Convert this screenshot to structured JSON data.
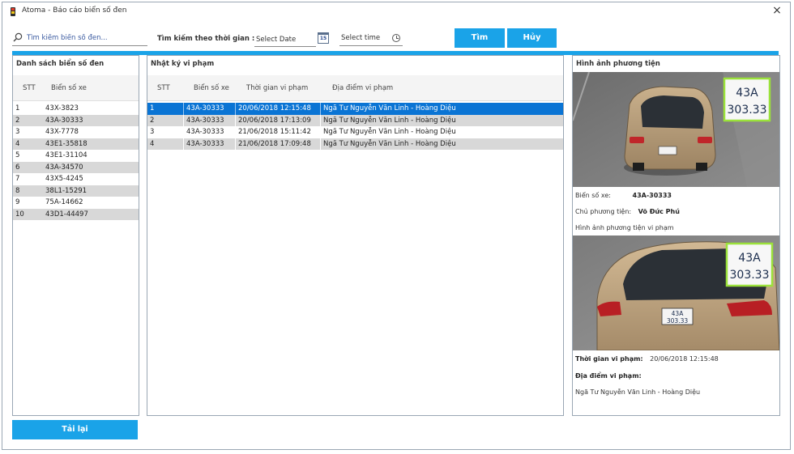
{
  "window": {
    "title": "Atoma - Báo cáo biển số đen",
    "close_glyph": "×"
  },
  "search": {
    "placeholder": "Tìm kiếm biển số đen...",
    "value": ""
  },
  "time_filter": {
    "label": "Tìm kiếm theo thời gian :",
    "date_placeholder": "Select Date",
    "calendar_glyph": "15",
    "time_placeholder": "Select time"
  },
  "buttons": {
    "find": "Tìm",
    "cancel": "Hủy",
    "reload": "Tải lại"
  },
  "colors": {
    "accent": "#1aa3e8",
    "selected_row": "#0a74d4",
    "alt_row": "#d8d8d8",
    "plate_box": "#9be23a"
  },
  "blacklist": {
    "title": "Danh sách biển số đen",
    "headers": [
      "STT",
      "Biển số xe"
    ],
    "rows": [
      [
        "1",
        "43X-3823"
      ],
      [
        "2",
        "43A-30333"
      ],
      [
        "3",
        "43X-7778"
      ],
      [
        "4",
        "43E1-35818"
      ],
      [
        "5",
        "43E1-31104"
      ],
      [
        "6",
        "43A-34570"
      ],
      [
        "7",
        "43X5-4245"
      ],
      [
        "8",
        "38L1-15291"
      ],
      [
        "9",
        "75A-14662"
      ],
      [
        "10",
        "43D1-44497"
      ]
    ]
  },
  "violations": {
    "title": "Nhật ký vi phạm",
    "headers": [
      "STT",
      "Biển số xe",
      "Thời gian vi phạm",
      "Địa điểm vi phạm"
    ],
    "rows": [
      [
        "1",
        "43A-30333",
        "20/06/2018 12:15:48",
        "Ngã Tư Nguyễn Văn Linh - Hoàng Diệu"
      ],
      [
        "2",
        "43A-30333",
        "20/06/2018 17:13:09",
        "Ngã Tư Nguyễn Văn Linh - Hoàng Diệu"
      ],
      [
        "3",
        "43A-30333",
        "21/06/2018 15:11:42",
        "Ngã Tư Nguyễn Văn Linh - Hoàng Diệu"
      ],
      [
        "4",
        "43A-30333",
        "21/06/2018 17:09:48",
        "Ngã Tư Nguyễn Văn Linh - Hoàng Diệu"
      ]
    ],
    "selected_index": 0
  },
  "vehicle": {
    "title": "Hình ảnh phương tiện",
    "plate_label": "Biển số xe:",
    "plate_value": "43A-30333",
    "owner_label": "Chủ phương tiện:",
    "owner_value": "Võ Đức Phú",
    "violation_image_label": "Hình ảnh phương tiện vi phạm",
    "time_label": "Thời gian vi phạm:",
    "time_value": "20/06/2018 12:15:48",
    "location_label": "Địa điểm vi phạm:",
    "location_value": "Ngã Tư Nguyễn Văn Linh - Hoàng Diệu",
    "plate_line1": "43A",
    "plate_line2": "303.33"
  }
}
